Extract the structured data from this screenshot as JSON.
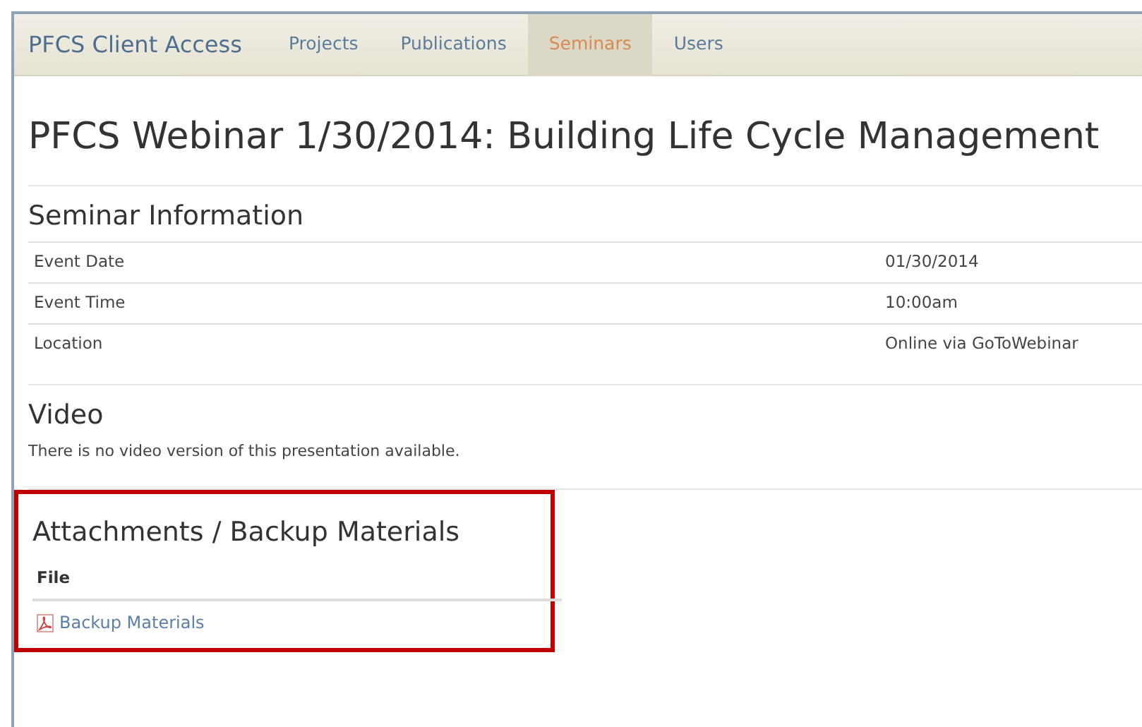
{
  "navbar": {
    "brand": "PFCS Client Access",
    "items": [
      {
        "label": "Projects",
        "selected": false
      },
      {
        "label": "Publications",
        "selected": false
      },
      {
        "label": "Seminars",
        "selected": true
      },
      {
        "label": "Users",
        "selected": false
      }
    ]
  },
  "page_title": "PFCS Webinar 1/30/2014: Building Life Cycle Management",
  "seminar_information": {
    "heading": "Seminar Information",
    "rows": [
      {
        "label": "Event Date",
        "value": "01/30/2014"
      },
      {
        "label": "Event Time",
        "value": "10:00am"
      },
      {
        "label": "Location",
        "value": "Online via GoToWebinar"
      }
    ]
  },
  "video": {
    "heading": "Video",
    "text": "There is no video version of this presentation available."
  },
  "attachments": {
    "heading": "Attachments / Backup Materials",
    "highlighted": true,
    "column": "File",
    "files": [
      {
        "name": "Backup Materials"
      }
    ]
  }
}
